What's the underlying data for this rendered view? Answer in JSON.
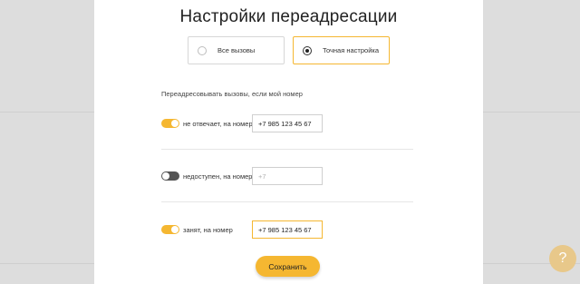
{
  "modal": {
    "title": "Настройки переадресации",
    "options": [
      {
        "label": "Все вызовы",
        "selected": false
      },
      {
        "label": "Точная настройка",
        "selected": true
      }
    ],
    "section_label": "Переадресовывать вызовы, если мой номер",
    "rows": [
      {
        "label": "не отвечает, на номер",
        "enabled": true,
        "value": "+7 985 123 45 67",
        "placeholder": ""
      },
      {
        "label": "недоступен, на номер",
        "enabled": false,
        "value": "",
        "placeholder": "+7"
      },
      {
        "label": "занят, на номер",
        "enabled": true,
        "value": "+7 985 123 45 67",
        "placeholder": ""
      }
    ],
    "save_label": "Сохранить"
  },
  "help": {
    "symbol": "?"
  },
  "colors": {
    "accent": "#f5b731",
    "toggle_off": "#555555",
    "backdrop": "#dddddd"
  },
  "icons": [
    "radio-unselected-icon",
    "radio-selected-icon",
    "toggle-on-icon",
    "toggle-off-icon",
    "help-icon"
  ]
}
